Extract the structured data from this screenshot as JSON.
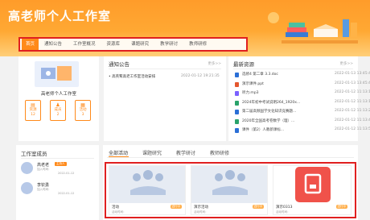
{
  "header": {
    "title": "高老师个人工作室"
  },
  "nav": {
    "tabs": [
      "首页",
      "通知公告",
      "工作室概况",
      "资源库",
      "课题研究",
      "教学研讨",
      "教师研修"
    ]
  },
  "profile": {
    "name": "高老师个人工作室",
    "stats": [
      {
        "label": "资源",
        "value": "12"
      },
      {
        "label": "成员",
        "value": "2"
      },
      {
        "label": "活动",
        "value": "3"
      }
    ]
  },
  "notice": {
    "title": "通知公告",
    "more": "更多>>",
    "items": [
      {
        "text": "• 高英鹭高老工作室活动安排",
        "date": "2022-01-12 19:21:35"
      }
    ]
  },
  "resources": {
    "title": "最新资源",
    "more": "更多>>",
    "items": [
      {
        "name": "选修4 第二章 3.3.doc",
        "date": "2022-01-13 13:45:46",
        "color": "#2b6fd6"
      },
      {
        "name": "演示课件.ppt",
        "date": "2022-01-13 13:45:46",
        "color": "#e4572e"
      },
      {
        "name": "听力.mp3",
        "date": "2022-01-12 11:13:10",
        "color": "#7b61ff"
      },
      {
        "name": "2024年初中考试说明264_1920x...",
        "date": "2022-01-12 11:13:12",
        "color": "#2aa36b"
      },
      {
        "name": "第二届高频国学文化知识竞赛题...",
        "date": "2022-01-12 11:13:21",
        "color": "#2b6fd6"
      },
      {
        "name": "2020年全国高考卷数学（理）...",
        "date": "2022-01-12 11:13:49",
        "color": "#2aa36b"
      },
      {
        "name": "课件（第2）人教新课标...",
        "date": "2022-01-12 11:13:50",
        "color": "#2b6fd6"
      }
    ]
  },
  "members": {
    "title": "工作室成员",
    "list": [
      {
        "name": "高老老",
        "badge": "主持人",
        "meta1": "加入时间：",
        "meta2": "2022-01-12"
      },
      {
        "name": "李钦勇",
        "badge": "",
        "meta1": "加入时间：",
        "meta2": "2022-01-12"
      }
    ]
  },
  "activities": {
    "tabs": [
      "全部活动",
      "课题研究",
      "教学研讨",
      "教师研修"
    ],
    "cards": [
      {
        "title": "活动",
        "tag": "进行中",
        "sub": "活动时间：",
        "thumb": "people"
      },
      {
        "title": "演示活动",
        "tag": "进行中",
        "sub": "活动时间：",
        "thumb": "people"
      },
      {
        "title": "演示0313",
        "tag": "进行中",
        "sub": "活动时间：",
        "thumb": "app"
      }
    ]
  },
  "colors": {
    "accent": "#ff8a1a",
    "highlight_border": "#e02020"
  }
}
